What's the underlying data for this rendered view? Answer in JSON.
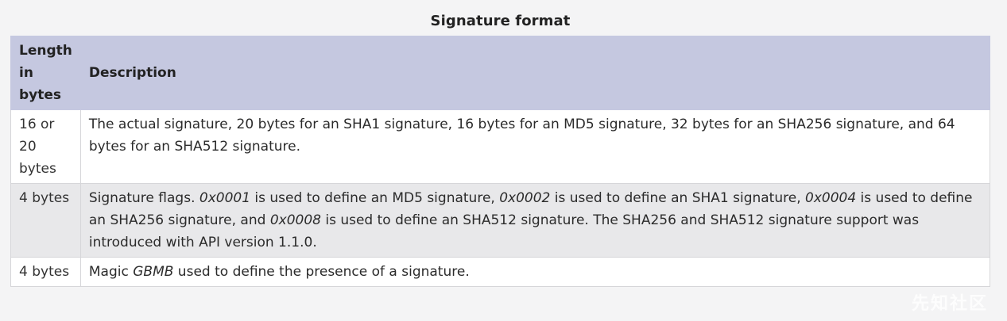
{
  "caption": "Signature format",
  "table": {
    "headers": {
      "length": "Length in bytes",
      "description": "Description"
    },
    "rows": [
      {
        "length": "16 or 20 bytes",
        "description": [
          {
            "t": "The actual signature, 20 bytes for an SHA1 signature, 16 bytes for an MD5 signature, 32 bytes for an SHA256 signature, and 64 bytes for an SHA512 signature."
          }
        ]
      },
      {
        "length": "4 bytes",
        "description": [
          {
            "t": "Signature flags. "
          },
          {
            "t": "0x0001",
            "em": true
          },
          {
            "t": " is used to define an MD5 signature, "
          },
          {
            "t": "0x0002",
            "em": true
          },
          {
            "t": " is used to define an SHA1 signature, "
          },
          {
            "t": "0x0004",
            "em": true
          },
          {
            "t": " is used to define an SHA256 signature, and "
          },
          {
            "t": "0x0008",
            "em": true
          },
          {
            "t": " is used to define an SHA512 signature. The SHA256 and SHA512 signature support was introduced with API version 1.1.0."
          }
        ]
      },
      {
        "length": "4 bytes",
        "description": [
          {
            "t": "Magic "
          },
          {
            "t": "GBMB",
            "em": true
          },
          {
            "t": " used to define the presence of a signature."
          }
        ]
      }
    ]
  },
  "watermark": "先知社区"
}
